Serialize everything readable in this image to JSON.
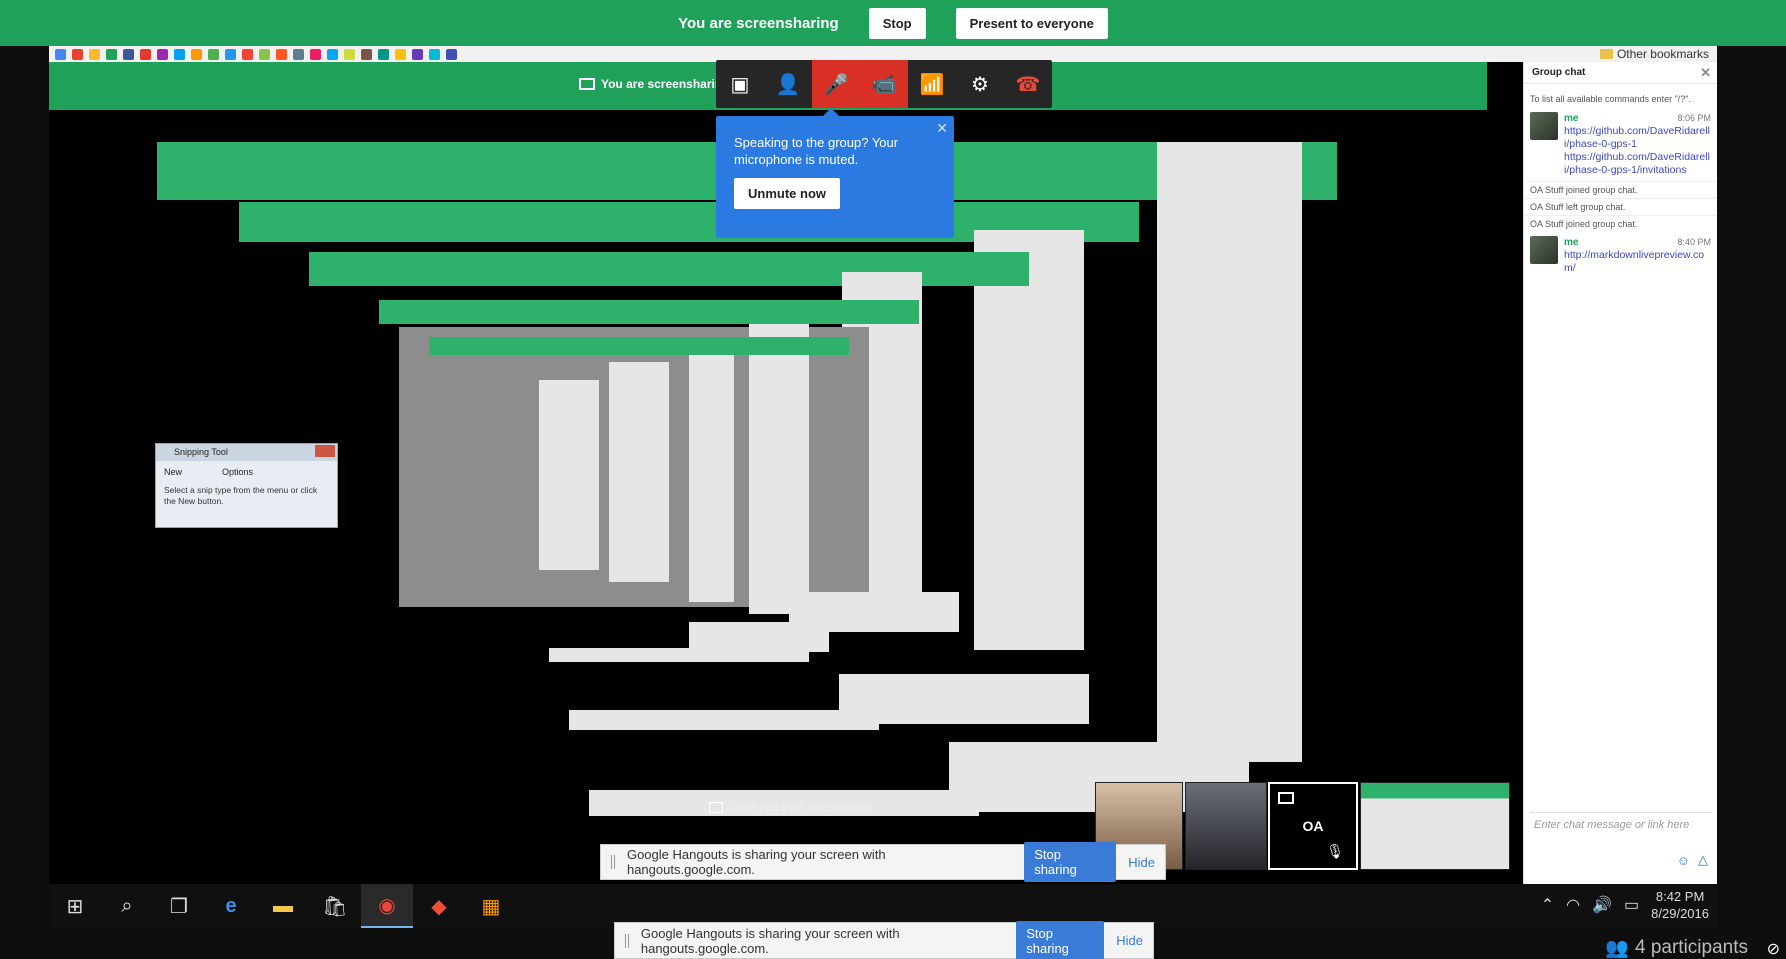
{
  "banner": {
    "status": "You are screensharing",
    "stop_label": "Stop",
    "present_label": "Present to everyone"
  },
  "bookmarks": {
    "other_label": "Other bookmarks",
    "colors": [
      "#4285f4",
      "#e94235",
      "#f9bb2d",
      "#1fa15a",
      "#3b5998",
      "#e23b2e",
      "#9c27b0",
      "#00a1f1",
      "#ff9800",
      "#4caf50",
      "#2196f3",
      "#f44336",
      "#8bc34a",
      "#ff5722",
      "#607d8b",
      "#e91e63",
      "#03a9f4",
      "#cddc39",
      "#795548",
      "#009688",
      "#ffc107",
      "#673ab7",
      "#00bcd4",
      "#3f51b5"
    ]
  },
  "hangout": {
    "presenter_note": "You are screensharing",
    "presenting_label": "Dave Ridarelli (presenting)"
  },
  "controls": {
    "items": [
      {
        "name": "screenshare-icon",
        "glyph": "▣",
        "red": false
      },
      {
        "name": "add-person-icon",
        "glyph": "👤",
        "red": false
      },
      {
        "name": "mic-muted-icon",
        "glyph": "🎤",
        "red": true
      },
      {
        "name": "camera-off-icon",
        "glyph": "📹",
        "red": true
      },
      {
        "name": "bandwidth-icon",
        "glyph": "📶",
        "red": false
      },
      {
        "name": "settings-icon",
        "glyph": "⚙",
        "red": false
      },
      {
        "name": "hangup-icon",
        "glyph": "☎",
        "red": false
      }
    ]
  },
  "tooltip": {
    "message": "Speaking to the group? Your microphone is muted.",
    "button": "Unmute now"
  },
  "chat": {
    "title": "Group chat",
    "hint": "To list all available commands enter \"/?\".",
    "messages": [
      {
        "name": "me",
        "time": "8:06 PM",
        "links": [
          "https://github.com/DaveRidarelli/phase-0-gps-1",
          "https://github.com/DaveRidarelli/phase-0-gps-1/invitations"
        ]
      },
      {
        "name": "me",
        "time": "8:40 PM",
        "links": [
          "http://markdownlivepreview.com/"
        ]
      }
    ],
    "system": [
      "OA Stuff joined group chat.",
      "OA Stuff left group chat.",
      "OA Stuff joined group chat."
    ],
    "input_placeholder": "Enter chat message or link here"
  },
  "filmstrip": {
    "oa_label": "OA"
  },
  "notice": {
    "text": "Google Hangouts is sharing your screen with hangouts.google.com.",
    "stop_label": "Stop sharing",
    "hide_label": "Hide"
  },
  "taskbar": {
    "time": "8:42 PM",
    "date": "8/29/2016"
  },
  "participants": "4 participants",
  "snip": {
    "title": "Snipping Tool",
    "new_label": "New",
    "options_label": "Options",
    "desc": "Select a snip type from the menu or click the New button."
  }
}
